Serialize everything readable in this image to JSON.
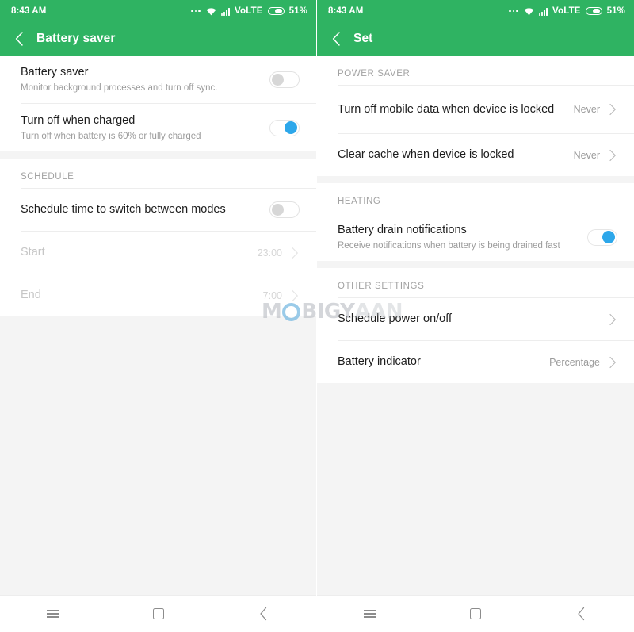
{
  "screens": [
    {
      "id": "battery-saver",
      "status_bar": {
        "time": "8:43 AM",
        "dots_icon": "more-icon",
        "wifi_icon": "wifi-icon",
        "signal_icon": "signal-icon",
        "network_label": "VoLTE",
        "battery_icon": "battery-icon",
        "battery_percent": "51%"
      },
      "app_bar": {
        "back_icon": "back-chevron-icon",
        "title": "Battery saver"
      },
      "sections": [
        {
          "header": null,
          "rows": [
            {
              "title": "Battery saver",
              "subtitle": "Monitor background processes and turn off sync.",
              "control": "toggle",
              "toggle_on": false,
              "disabled": false
            },
            {
              "title": "Turn off when charged",
              "subtitle": "Turn off when battery is 60% or fully charged",
              "control": "toggle",
              "toggle_on": true,
              "disabled": false
            }
          ]
        },
        {
          "header": "SCHEDULE",
          "rows": [
            {
              "title": "Schedule time to switch between modes",
              "subtitle": null,
              "control": "toggle",
              "toggle_on": false,
              "disabled": false
            },
            {
              "title": "Start",
              "subtitle": null,
              "control": "value",
              "value": "23:00",
              "disabled": true
            },
            {
              "title": "End",
              "subtitle": null,
              "control": "value",
              "value": "7:00",
              "disabled": true
            }
          ]
        }
      ],
      "nav_bar": {
        "menu_icon": "menu-icon",
        "home_icon": "home-square-icon",
        "back_icon": "back-chevron-icon"
      }
    },
    {
      "id": "settings",
      "status_bar": {
        "time": "8:43 AM",
        "dots_icon": "more-icon",
        "wifi_icon": "wifi-icon",
        "signal_icon": "signal-icon",
        "network_label": "VoLTE",
        "battery_icon": "battery-icon",
        "battery_percent": "51%"
      },
      "app_bar": {
        "back_icon": "back-chevron-icon",
        "title": "Set"
      },
      "sections": [
        {
          "header": "POWER SAVER",
          "rows": [
            {
              "title": "Turn off mobile data when device is locked",
              "subtitle": null,
              "control": "value",
              "value": "Never",
              "disabled": false
            },
            {
              "title": "Clear cache when device is locked",
              "subtitle": null,
              "control": "value",
              "value": "Never",
              "disabled": false
            }
          ]
        },
        {
          "header": "HEATING",
          "rows": [
            {
              "title": "Battery drain notifications",
              "subtitle": "Receive notifications when battery is being drained fast",
              "control": "toggle",
              "toggle_on": true,
              "disabled": false
            }
          ]
        },
        {
          "header": "OTHER SETTINGS",
          "rows": [
            {
              "title": "Schedule power on/off",
              "subtitle": null,
              "control": "value",
              "value": "",
              "disabled": false
            },
            {
              "title": "Battery indicator",
              "subtitle": null,
              "control": "value",
              "value": "Percentage",
              "disabled": false
            }
          ]
        }
      ],
      "nav_bar": {
        "menu_icon": "menu-icon",
        "home_icon": "home-square-icon",
        "back_icon": "back-chevron-icon"
      }
    }
  ],
  "watermark": {
    "prefix": "M",
    "middle": "BIGY",
    "suffix": "AAN"
  },
  "colors": {
    "header_green": "#2FB362",
    "toggle_on_blue": "#2DA7EA",
    "toggle_off_gray": "#d7d7d7",
    "page_background": "#f4f4f4",
    "list_background": "#ffffff",
    "title_text": "#1d1d1d",
    "subtitle_text": "#9b9b9b",
    "disabled_text": "#c6c6c6"
  }
}
